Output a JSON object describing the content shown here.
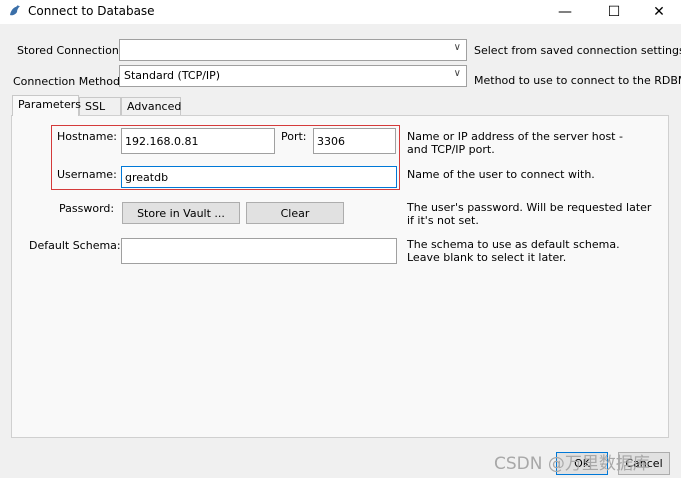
{
  "window": {
    "title": "Connect to Database",
    "controls": {
      "minimize": "—",
      "maximize": "☐",
      "close": "✕"
    }
  },
  "stored_connection": {
    "label": "Stored Connection:",
    "value": "",
    "hint": "Select from saved connection settings"
  },
  "connection_method": {
    "label": "Connection Method:",
    "value": "Standard (TCP/IP)",
    "hint": "Method to use to connect to the RDBMS"
  },
  "tabs": [
    "Parameters",
    "SSL",
    "Advanced"
  ],
  "parameters": {
    "hostname_label": "Hostname:",
    "hostname_value": "192.168.0.81",
    "port_label": "Port:",
    "port_value": "3306",
    "host_hint": "Name or IP address of the server host - and TCP/IP port.",
    "username_label": "Username:",
    "username_value": "greatdb",
    "username_hint": "Name of the user to connect with.",
    "password_label": "Password:",
    "store_vault_label": "Store in Vault ...",
    "clear_label": "Clear",
    "password_hint": "The user's password. Will be requested later if it's not set.",
    "schema_label": "Default Schema:",
    "schema_value": "",
    "schema_hint": "The schema to use as default schema. Leave blank to select it later."
  },
  "footer": {
    "ok_label": "OK",
    "cancel_label": "Cancel",
    "watermark": "CSDN @万里数据库"
  },
  "colors": {
    "highlight_box": "#d43a3a",
    "focus_border": "#0078d7"
  }
}
